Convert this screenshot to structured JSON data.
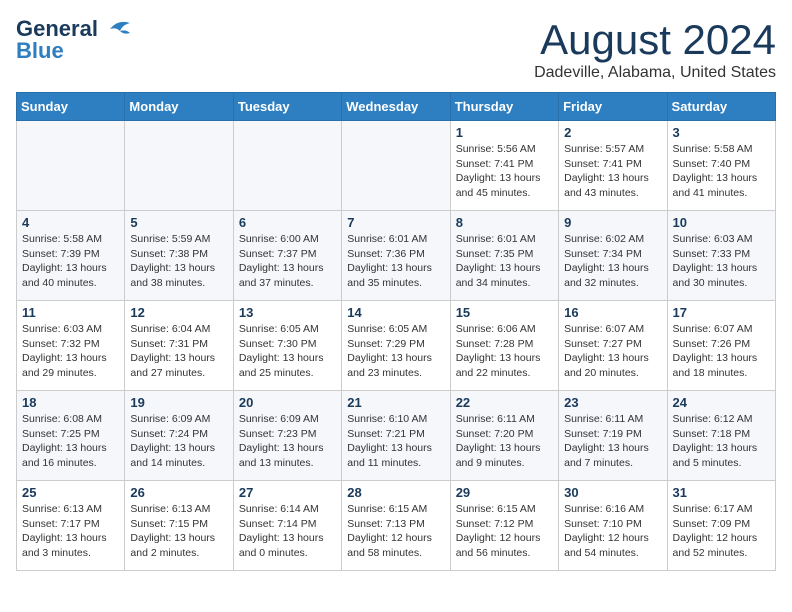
{
  "header": {
    "logo_line1": "General",
    "logo_line2": "Blue",
    "month": "August 2024",
    "location": "Dadeville, Alabama, United States"
  },
  "weekdays": [
    "Sunday",
    "Monday",
    "Tuesday",
    "Wednesday",
    "Thursday",
    "Friday",
    "Saturday"
  ],
  "weeks": [
    [
      {
        "day": "",
        "info": ""
      },
      {
        "day": "",
        "info": ""
      },
      {
        "day": "",
        "info": ""
      },
      {
        "day": "",
        "info": ""
      },
      {
        "day": "1",
        "info": "Sunrise: 5:56 AM\nSunset: 7:41 PM\nDaylight: 13 hours\nand 45 minutes."
      },
      {
        "day": "2",
        "info": "Sunrise: 5:57 AM\nSunset: 7:41 PM\nDaylight: 13 hours\nand 43 minutes."
      },
      {
        "day": "3",
        "info": "Sunrise: 5:58 AM\nSunset: 7:40 PM\nDaylight: 13 hours\nand 41 minutes."
      }
    ],
    [
      {
        "day": "4",
        "info": "Sunrise: 5:58 AM\nSunset: 7:39 PM\nDaylight: 13 hours\nand 40 minutes."
      },
      {
        "day": "5",
        "info": "Sunrise: 5:59 AM\nSunset: 7:38 PM\nDaylight: 13 hours\nand 38 minutes."
      },
      {
        "day": "6",
        "info": "Sunrise: 6:00 AM\nSunset: 7:37 PM\nDaylight: 13 hours\nand 37 minutes."
      },
      {
        "day": "7",
        "info": "Sunrise: 6:01 AM\nSunset: 7:36 PM\nDaylight: 13 hours\nand 35 minutes."
      },
      {
        "day": "8",
        "info": "Sunrise: 6:01 AM\nSunset: 7:35 PM\nDaylight: 13 hours\nand 34 minutes."
      },
      {
        "day": "9",
        "info": "Sunrise: 6:02 AM\nSunset: 7:34 PM\nDaylight: 13 hours\nand 32 minutes."
      },
      {
        "day": "10",
        "info": "Sunrise: 6:03 AM\nSunset: 7:33 PM\nDaylight: 13 hours\nand 30 minutes."
      }
    ],
    [
      {
        "day": "11",
        "info": "Sunrise: 6:03 AM\nSunset: 7:32 PM\nDaylight: 13 hours\nand 29 minutes."
      },
      {
        "day": "12",
        "info": "Sunrise: 6:04 AM\nSunset: 7:31 PM\nDaylight: 13 hours\nand 27 minutes."
      },
      {
        "day": "13",
        "info": "Sunrise: 6:05 AM\nSunset: 7:30 PM\nDaylight: 13 hours\nand 25 minutes."
      },
      {
        "day": "14",
        "info": "Sunrise: 6:05 AM\nSunset: 7:29 PM\nDaylight: 13 hours\nand 23 minutes."
      },
      {
        "day": "15",
        "info": "Sunrise: 6:06 AM\nSunset: 7:28 PM\nDaylight: 13 hours\nand 22 minutes."
      },
      {
        "day": "16",
        "info": "Sunrise: 6:07 AM\nSunset: 7:27 PM\nDaylight: 13 hours\nand 20 minutes."
      },
      {
        "day": "17",
        "info": "Sunrise: 6:07 AM\nSunset: 7:26 PM\nDaylight: 13 hours\nand 18 minutes."
      }
    ],
    [
      {
        "day": "18",
        "info": "Sunrise: 6:08 AM\nSunset: 7:25 PM\nDaylight: 13 hours\nand 16 minutes."
      },
      {
        "day": "19",
        "info": "Sunrise: 6:09 AM\nSunset: 7:24 PM\nDaylight: 13 hours\nand 14 minutes."
      },
      {
        "day": "20",
        "info": "Sunrise: 6:09 AM\nSunset: 7:23 PM\nDaylight: 13 hours\nand 13 minutes."
      },
      {
        "day": "21",
        "info": "Sunrise: 6:10 AM\nSunset: 7:21 PM\nDaylight: 13 hours\nand 11 minutes."
      },
      {
        "day": "22",
        "info": "Sunrise: 6:11 AM\nSunset: 7:20 PM\nDaylight: 13 hours\nand 9 minutes."
      },
      {
        "day": "23",
        "info": "Sunrise: 6:11 AM\nSunset: 7:19 PM\nDaylight: 13 hours\nand 7 minutes."
      },
      {
        "day": "24",
        "info": "Sunrise: 6:12 AM\nSunset: 7:18 PM\nDaylight: 13 hours\nand 5 minutes."
      }
    ],
    [
      {
        "day": "25",
        "info": "Sunrise: 6:13 AM\nSunset: 7:17 PM\nDaylight: 13 hours\nand 3 minutes."
      },
      {
        "day": "26",
        "info": "Sunrise: 6:13 AM\nSunset: 7:15 PM\nDaylight: 13 hours\nand 2 minutes."
      },
      {
        "day": "27",
        "info": "Sunrise: 6:14 AM\nSunset: 7:14 PM\nDaylight: 13 hours\nand 0 minutes."
      },
      {
        "day": "28",
        "info": "Sunrise: 6:15 AM\nSunset: 7:13 PM\nDaylight: 12 hours\nand 58 minutes."
      },
      {
        "day": "29",
        "info": "Sunrise: 6:15 AM\nSunset: 7:12 PM\nDaylight: 12 hours\nand 56 minutes."
      },
      {
        "day": "30",
        "info": "Sunrise: 6:16 AM\nSunset: 7:10 PM\nDaylight: 12 hours\nand 54 minutes."
      },
      {
        "day": "31",
        "info": "Sunrise: 6:17 AM\nSunset: 7:09 PM\nDaylight: 12 hours\nand 52 minutes."
      }
    ]
  ]
}
